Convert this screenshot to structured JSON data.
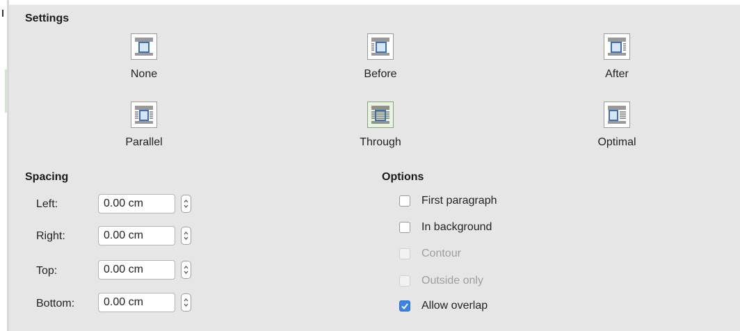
{
  "settings": {
    "title": "Settings",
    "wrap_options": [
      {
        "id": "none",
        "label": "None",
        "selected": false
      },
      {
        "id": "before",
        "label": "Before",
        "selected": false
      },
      {
        "id": "after",
        "label": "After",
        "selected": false
      },
      {
        "id": "parallel",
        "label": "Parallel",
        "selected": false
      },
      {
        "id": "through",
        "label": "Through",
        "selected": true
      },
      {
        "id": "optimal",
        "label": "Optimal",
        "selected": false
      }
    ]
  },
  "spacing": {
    "title": "Spacing",
    "fields": [
      {
        "label": "Left:",
        "value": "0.00 cm"
      },
      {
        "label": "Right:",
        "value": "0.00 cm"
      },
      {
        "label": "Top:",
        "value": "0.00 cm"
      },
      {
        "label": "Bottom:",
        "value": "0.00 cm"
      }
    ]
  },
  "options": {
    "title": "Options",
    "items": [
      {
        "label": "First paragraph",
        "checked": false,
        "enabled": true
      },
      {
        "label": "In background",
        "checked": false,
        "enabled": true
      },
      {
        "label": "Contour",
        "checked": false,
        "enabled": false
      },
      {
        "label": "Outside only",
        "checked": false,
        "enabled": false
      },
      {
        "label": "Allow overlap",
        "checked": true,
        "enabled": true
      }
    ]
  },
  "colors": {
    "accent": "#3a83e5",
    "panel": "#e6e6e6",
    "disabled_text": "#9e9e9e"
  },
  "icons": {
    "wrap": "wrap-mode-icon",
    "spin": "spin-updown-icon",
    "check": "checkmark-icon"
  }
}
